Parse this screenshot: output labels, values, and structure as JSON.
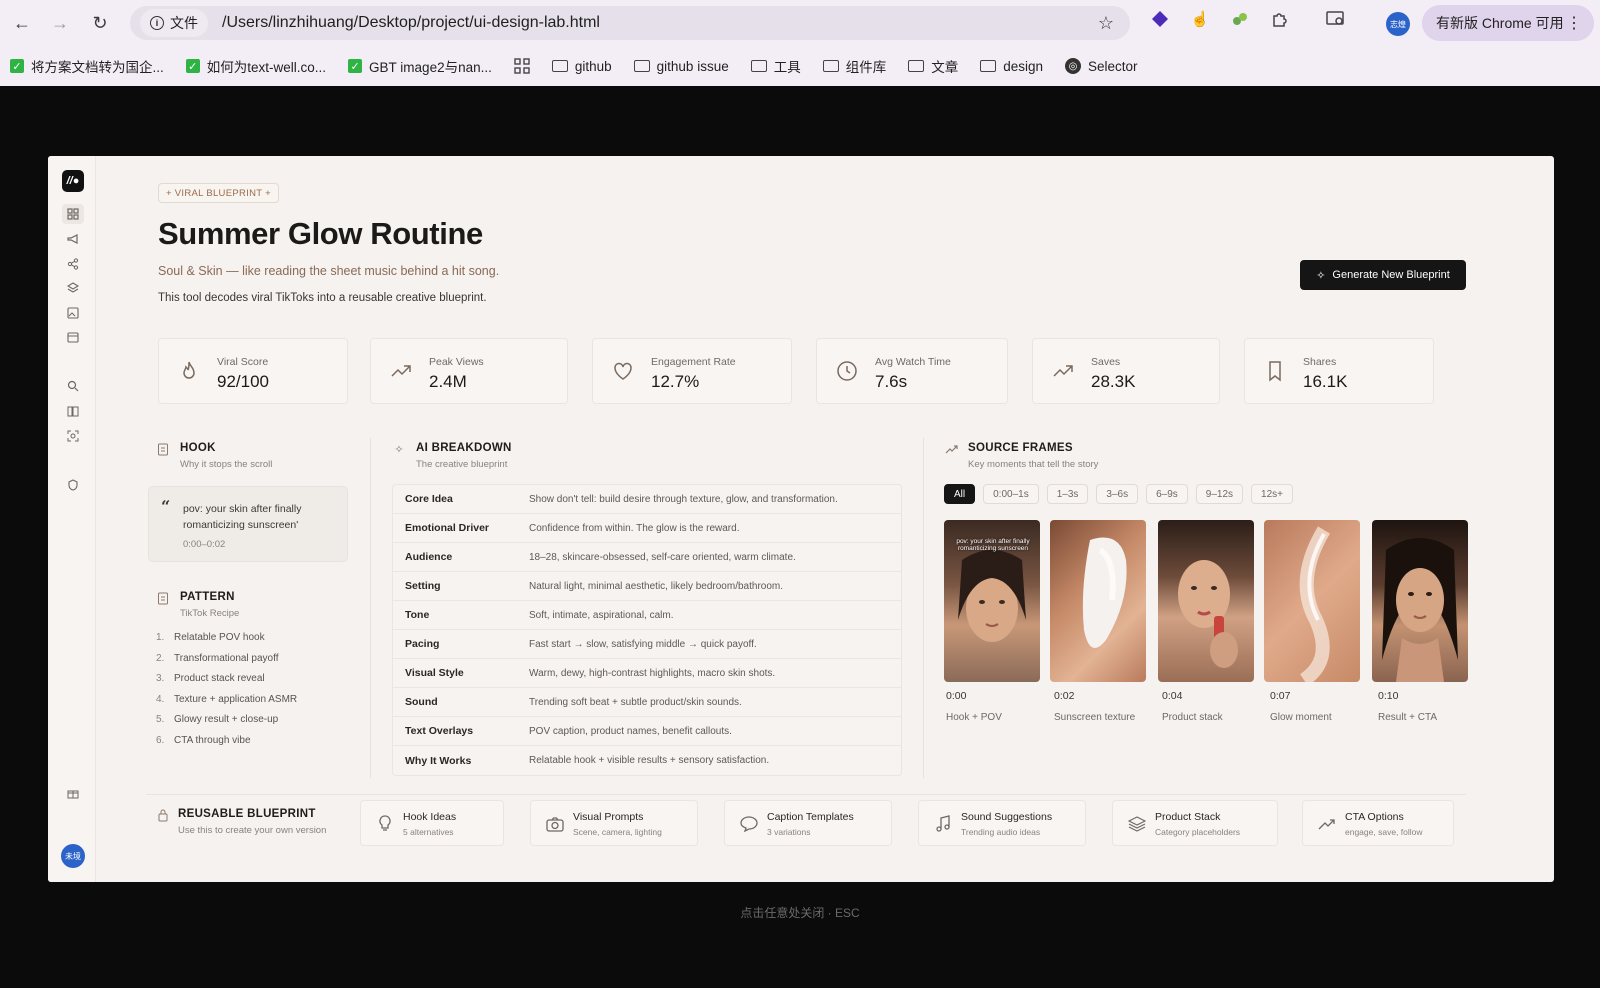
{
  "browser": {
    "info_label": "文件",
    "url": "/Users/linzhihuang/Desktop/project/ui-design-lab.html",
    "profile_initials": "志煌",
    "update_label": "有新版 Chrome 可用"
  },
  "bookmarks": [
    {
      "label": "将方案文档转为国企...",
      "type": "check"
    },
    {
      "label": "如何为text-well.co...",
      "type": "check"
    },
    {
      "label": "GBT image2与nan...",
      "type": "check"
    },
    {
      "label": "github",
      "type": "folder"
    },
    {
      "label": "github issue",
      "type": "folder"
    },
    {
      "label": "工具",
      "type": "folder"
    },
    {
      "label": "组件库",
      "type": "folder"
    },
    {
      "label": "文章",
      "type": "folder"
    },
    {
      "label": "design",
      "type": "folder"
    },
    {
      "label": "Selector",
      "type": "globe"
    }
  ],
  "page": {
    "badge": "+ VIRAL BLUEPRINT +",
    "title": "Summer Glow Routine",
    "subtitle": "Soul & Skin — like reading the sheet music behind a hit song.",
    "description": "This tool decodes viral TikToks into a reusable creative blueprint.",
    "generate_button": "Generate New Blueprint",
    "avatar_initials": "未境"
  },
  "stats": [
    {
      "label": "Viral Score",
      "value": "92/100",
      "icon": "flame-icon"
    },
    {
      "label": "Peak Views",
      "value": "2.4M",
      "icon": "trend-up-icon"
    },
    {
      "label": "Engagement Rate",
      "value": "12.7%",
      "icon": "heart-icon"
    },
    {
      "label": "Avg Watch Time",
      "value": "7.6s",
      "icon": "clock-icon"
    },
    {
      "label": "Saves",
      "value": "28.3K",
      "icon": "trend-up-icon"
    },
    {
      "label": "Shares",
      "value": "16.1K",
      "icon": "bookmark-icon"
    }
  ],
  "hook": {
    "title": "HOOK",
    "subtitle": "Why it stops the scroll",
    "quote": "pov: your skin after finally romanticizing sunscreen'",
    "time": "0:00–0:02"
  },
  "pattern": {
    "title": "PATTERN",
    "subtitle": "TikTok Recipe",
    "items": [
      "Relatable POV hook",
      "Transformational payoff",
      "Product stack reveal",
      "Texture + application ASMR",
      "Glowy result + close-up",
      "CTA through vibe"
    ]
  },
  "breakdown": {
    "title": "AI BREAKDOWN",
    "subtitle": "The creative blueprint",
    "rows": [
      {
        "key": "Core Idea",
        "value": "Show don't tell: build desire through texture, glow, and transformation."
      },
      {
        "key": "Emotional Driver",
        "value": "Confidence from within. The glow is the reward."
      },
      {
        "key": "Audience",
        "value": "18–28, skincare-obsessed, self-care oriented, warm climate."
      },
      {
        "key": "Setting",
        "value": "Natural light, minimal aesthetic, likely bedroom/bathroom."
      },
      {
        "key": "Tone",
        "value": "Soft, intimate, aspirational, calm."
      },
      {
        "key": "Pacing",
        "value": "Fast start → slow, satisfying middle → quick payoff."
      },
      {
        "key": "Visual Style",
        "value": "Warm, dewy, high-contrast highlights, macro skin shots."
      },
      {
        "key": "Sound",
        "value": "Trending soft beat + subtle product/skin sounds."
      },
      {
        "key": "Text Overlays",
        "value": "POV caption, product names, benefit callouts."
      },
      {
        "key": "Why It Works",
        "value": "Relatable hook + visible results + sensory satisfaction."
      }
    ]
  },
  "frames": {
    "title": "SOURCE FRAMES",
    "subtitle": "Key moments that tell the story",
    "filters": [
      "All",
      "0:00–1s",
      "1–3s",
      "3–6s",
      "6–9s",
      "9–12s",
      "12s+"
    ],
    "active_filter": "All",
    "overlay_text": "pov: your skin after finally romanticizing sunscreen",
    "items": [
      {
        "time": "0:00",
        "caption": "Hook + POV"
      },
      {
        "time": "0:02",
        "caption": "Sunscreen texture"
      },
      {
        "time": "0:04",
        "caption": "Product stack"
      },
      {
        "time": "0:07",
        "caption": "Glow moment"
      },
      {
        "time": "0:10",
        "caption": "Result + CTA"
      }
    ]
  },
  "bottom": {
    "title": "REUSABLE BLUEPRINT",
    "subtitle": "Use this to create your own version",
    "cards": [
      {
        "title": "Hook Ideas",
        "sub": "5 alternatives",
        "icon": "lightbulb-icon"
      },
      {
        "title": "Visual Prompts",
        "sub": "Scene, camera, lighting",
        "icon": "camera-icon"
      },
      {
        "title": "Caption Templates",
        "sub": "3 variations",
        "icon": "chat-icon"
      },
      {
        "title": "Sound Suggestions",
        "sub": "Trending audio ideas",
        "icon": "music-icon"
      },
      {
        "title": "Product Stack",
        "sub": "Category placeholders",
        "icon": "layers-icon"
      },
      {
        "title": "CTA Options",
        "sub": "engage, save, follow",
        "icon": "trend-up-icon"
      }
    ]
  },
  "close_hint": "点击任意处关闭 · ESC"
}
